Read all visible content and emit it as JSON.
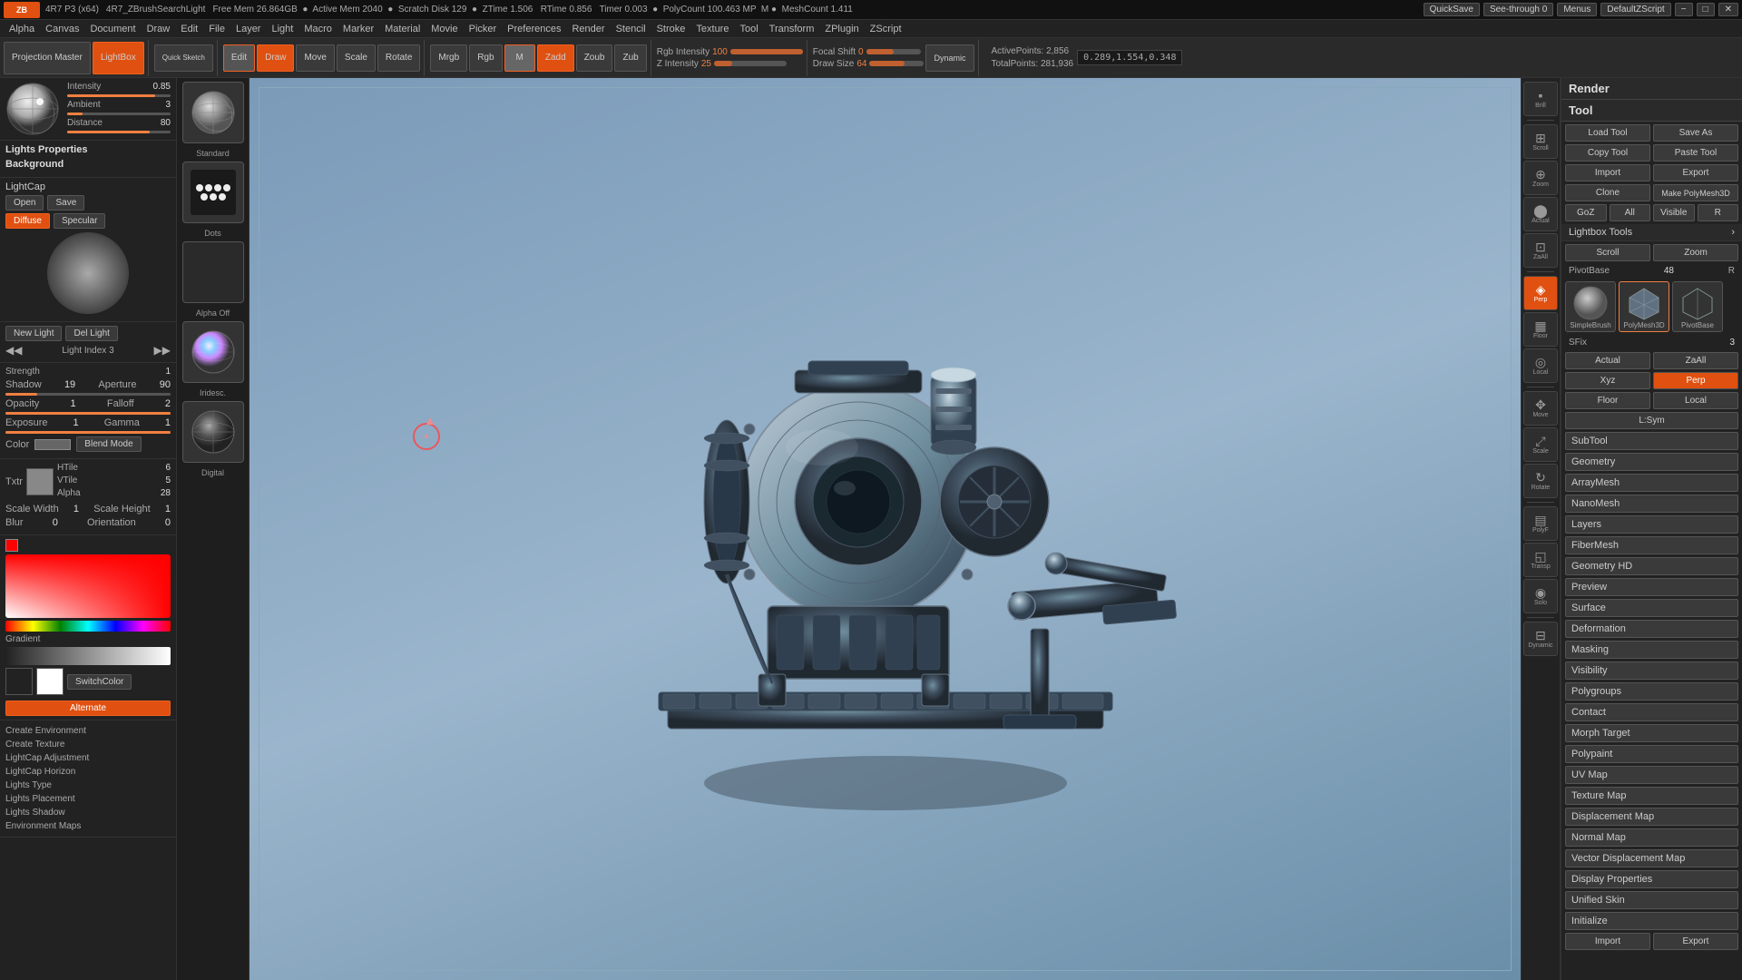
{
  "topbar": {
    "app_name": "ZBrush",
    "version": "4R7 P3 (x64)",
    "window_title": "4R7_ZBrushSearchLight",
    "free_mem": "Free Mem 26.864GB",
    "active_mem": "Active Mem 2040",
    "scratch": "Scratch Disk 129",
    "ztime": "ZTime 1.506",
    "rtime": "RTime 0.856",
    "timer": "Timer 0.003",
    "polycount": "PolyCount 100.463 MP",
    "mesh_count": "MeshCount 1.411",
    "quicksave_label": "QuickSave",
    "see_through_label": "See-through",
    "see_through_val": "0",
    "menus_label": "Menus",
    "script_label": "DefaultZScript"
  },
  "menubar": {
    "items": [
      "Alpha",
      "Canvas",
      "Document",
      "Draw",
      "Edit",
      "File",
      "Layer",
      "Light",
      "Macro",
      "Marker",
      "Material",
      "Movie",
      "Picker",
      "Preferences",
      "Render",
      "Stencil",
      "Stroke",
      "Texture",
      "Tool",
      "Transform",
      "ZPlugin",
      "ZScript"
    ]
  },
  "toolbar": {
    "projection_master_label": "Projection Master",
    "lightbox_label": "LightBox",
    "quick_sketch_label": "Quick Sketch",
    "edit_label": "Edit",
    "draw_label": "Draw",
    "move_label": "Move",
    "scale_label": "Scale",
    "rotate_label": "Rotate",
    "mrgb_label": "Mrgb",
    "rgb_label": "Rgb",
    "m_label": "M",
    "zadd_label": "Zadd",
    "zoub_label": "Zoub",
    "zub_label": "Zub",
    "rgb_intensity_label": "Rgb Intensity",
    "rgb_intensity_val": "100",
    "z_intensity_label": "Z Intensity",
    "z_intensity_val": "25",
    "focal_shift_label": "Focal Shift",
    "focal_shift_val": "0",
    "draw_size_label": "Draw Size",
    "draw_size_val": "64",
    "dynamic_label": "Dynamic",
    "active_points": "ActivePoints: 2,856",
    "total_points": "TotalPoints: 281,936",
    "coords": "0.289,1.554,0.348"
  },
  "left_panel": {
    "lights_properties_title": "Lights Properties",
    "background_title": "Background",
    "lightcap_label": "LightCap",
    "open_label": "Open",
    "save_label": "Save",
    "diffuse_label": "Diffuse",
    "specular_label": "Specular",
    "intensity_label": "Intensity",
    "intensity_val": "0.85",
    "ambient_label": "Ambient",
    "ambient_val": "3",
    "distance_label": "Distance",
    "distance_val": "80",
    "new_light_label": "New Light",
    "del_light_label": "Del Light",
    "light_index_label": "Light Index",
    "light_index_val": "3",
    "strength_label": "Strength",
    "strength_val": "1",
    "shadow_label": "Shadow",
    "shadow_val": "19",
    "aperture_label": "Aperture",
    "aperture_val": "90",
    "opacity_label": "Opacity",
    "opacity_val": "1",
    "falloff_label": "Falloff",
    "falloff_val": "2",
    "exposure_label": "Exposure",
    "exposure_val": "1",
    "gamma_label": "Gamma",
    "gamma_val": "1",
    "color_label": "Color",
    "blend_mode_label": "Blend Mode",
    "htile_label": "HTile",
    "htile_val": "6",
    "vtile_label": "VTile",
    "vtile_val": "5",
    "alpha_label": "Alpha",
    "alpha_val": "28",
    "scale_width_label": "Scale Width",
    "scale_width_val": "1",
    "scale_height_label": "Scale Height",
    "scale_height_val": "1",
    "orientation_label": "Orientation",
    "orientation_val": "0",
    "blur_label": "Blur",
    "blur_val": "0",
    "txtr_label": "Txtr",
    "gradient_label": "Gradient",
    "switch_color_label": "SwitchColor",
    "alternate_label": "Alternate",
    "create_environment_label": "Create Environment",
    "create_texture_label": "Create Texture",
    "lightcap_adjustment_label": "LightCap Adjustment",
    "lightcap_horizon_label": "LightCap Horizon",
    "lights_type_label": "Lights Type",
    "lights_placement_label": "Lights Placement",
    "lights_shadow_label": "Lights Shadow",
    "environment_maps_label": "Environment Maps"
  },
  "lightcap_panel": {
    "thumbs": [
      {
        "label": "Standard",
        "type": "sphere-gray"
      },
      {
        "label": "Dots",
        "type": "dots"
      },
      {
        "label": "Alpha Off",
        "type": "blank"
      },
      {
        "label": "Iridesc.",
        "type": "sphere-rainbow"
      },
      {
        "label": "Digital",
        "type": "sphere-dark"
      }
    ]
  },
  "right_panel": {
    "render_title": "Render",
    "tool_title": "Tool",
    "load_tool_label": "Load Tool",
    "save_as_label": "Save As",
    "copy_tool_label": "Copy Tool",
    "paste_tool_label": "Paste Tool",
    "import_label": "Import",
    "export_label": "Export",
    "clone_label": "Clone",
    "make_polymesh3d_label": "Make PolyMesh3D",
    "goz_label": "GoZ",
    "all_label": "All",
    "visible_label": "Visible",
    "r_label": "R",
    "lightbox_tools_label": "Lightbox Tools",
    "scroll_label": "Scroll",
    "pivot_base_label": "PivotBase",
    "pivot_base_val": "48",
    "zoom_label": "Zoom",
    "actual_label": "Actual",
    "zaall_label": "ZaAll",
    "xyz_label": "Xyz",
    "persp_label": "Perp",
    "floor_label": "Floor",
    "local_label": "Local",
    "sym_label": "L:Sym",
    "subtool_label": "SubTool",
    "geometry_label": "Geometry",
    "arraymesh_label": "ArrayMesh",
    "nanomesh_label": "NanoMesh",
    "layers_label": "Layers",
    "fibermesh_label": "FiberMesh",
    "geometry_hd_label": "Geometry HD",
    "preview_label": "Preview",
    "surface_label": "Surface",
    "deformation_label": "Deformation",
    "masking_label": "Masking",
    "visibility_label": "Visibility",
    "polygroups_label": "Polygroups",
    "contact_label": "Contact",
    "morph_target_label": "Morph Target",
    "polypaint_label": "Polypaint",
    "uv_map_label": "UV Map",
    "texture_map_label": "Texture Map",
    "displacement_map_label": "Displacement Map",
    "normal_map_label": "Normal Map",
    "vector_displacement_map_label": "Vector Displacement Map",
    "display_properties_label": "Display Properties",
    "unified_skin_label": "Unified Skin",
    "initialize_label": "Initialize",
    "import2_label": "Import",
    "export2_label": "Export",
    "tool_thumbs": [
      {
        "label": "SimpleBrush",
        "type": "simple"
      },
      {
        "label": "PivotBase",
        "type": "pivot"
      }
    ],
    "selected_tool_icon": "PolyMesh3D",
    "sfix_label": "SFix",
    "sfix_val": "3"
  },
  "icon_sidebar": {
    "buttons": [
      {
        "sym": "⬛",
        "label": "Brill",
        "active": false
      },
      {
        "sym": "✦",
        "label": "Scroll",
        "active": false
      },
      {
        "sym": "⊕",
        "label": "Zoom",
        "active": false
      },
      {
        "sym": "⬤",
        "label": "Actual",
        "active": false
      },
      {
        "sym": "⊞",
        "label": "ZaAll",
        "active": false
      },
      {
        "sym": "⬛",
        "label": "Perp",
        "active": true
      },
      {
        "sym": "▦",
        "label": "Floor",
        "active": false
      },
      {
        "sym": "◎",
        "label": "Local",
        "active": false
      },
      {
        "sym": "↔",
        "label": "Move",
        "active": false
      },
      {
        "sym": "⊡",
        "label": "Scale",
        "active": false
      },
      {
        "sym": "↻",
        "label": "Rotate",
        "active": false
      },
      {
        "sym": "▤",
        "label": "PolyF",
        "active": false
      },
      {
        "sym": "◫",
        "label": "Transp",
        "active": false
      },
      {
        "sym": "↕",
        "label": "Solo",
        "active": false
      },
      {
        "sym": "⊟",
        "label": "Dynamic",
        "active": false
      }
    ]
  },
  "colors": {
    "accent_orange": "#e05010",
    "accent_blue": "#2060a0",
    "bg_dark": "#1a1a1a",
    "bg_panel": "#222222",
    "text_primary": "#cccccc",
    "text_dim": "#999999",
    "slider_fill": "#f08040"
  }
}
